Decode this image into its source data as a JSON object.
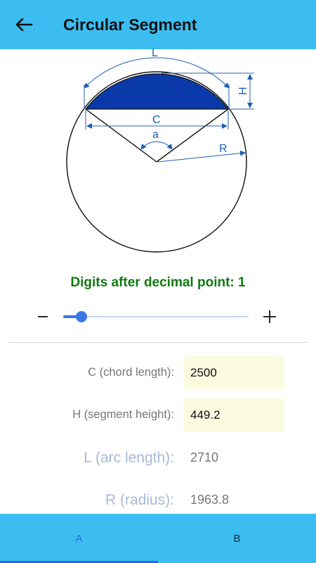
{
  "header": {
    "title": "Circular Segment",
    "back_icon": "arrow-left-icon"
  },
  "diagram": {
    "labels": {
      "L": "L",
      "H": "H",
      "C": "C",
      "a": "a",
      "R": "R"
    },
    "segment_color": "#0a3aaa",
    "dimension_color": "#1f5fb4"
  },
  "precision": {
    "label": "Digits after decimal point: 1",
    "value": 1,
    "min": 0,
    "max": 10,
    "minus_symbol": "–",
    "plus_symbol": "+"
  },
  "inputs": {
    "chord": {
      "label": "C (chord length):",
      "value": "2500"
    },
    "height": {
      "label": "H (segment height):",
      "value": "449.2"
    }
  },
  "outputs": {
    "arc": {
      "label": "L (arc length):",
      "value": "2710"
    },
    "radius": {
      "label": "R (radius):",
      "value": "1963.8"
    }
  },
  "tabs": {
    "a": "A",
    "b": "B",
    "selected": "A"
  },
  "colors": {
    "bar": "#3cbdf1",
    "accent": "#2a66e6",
    "heading_green": "#0f7a0f"
  }
}
